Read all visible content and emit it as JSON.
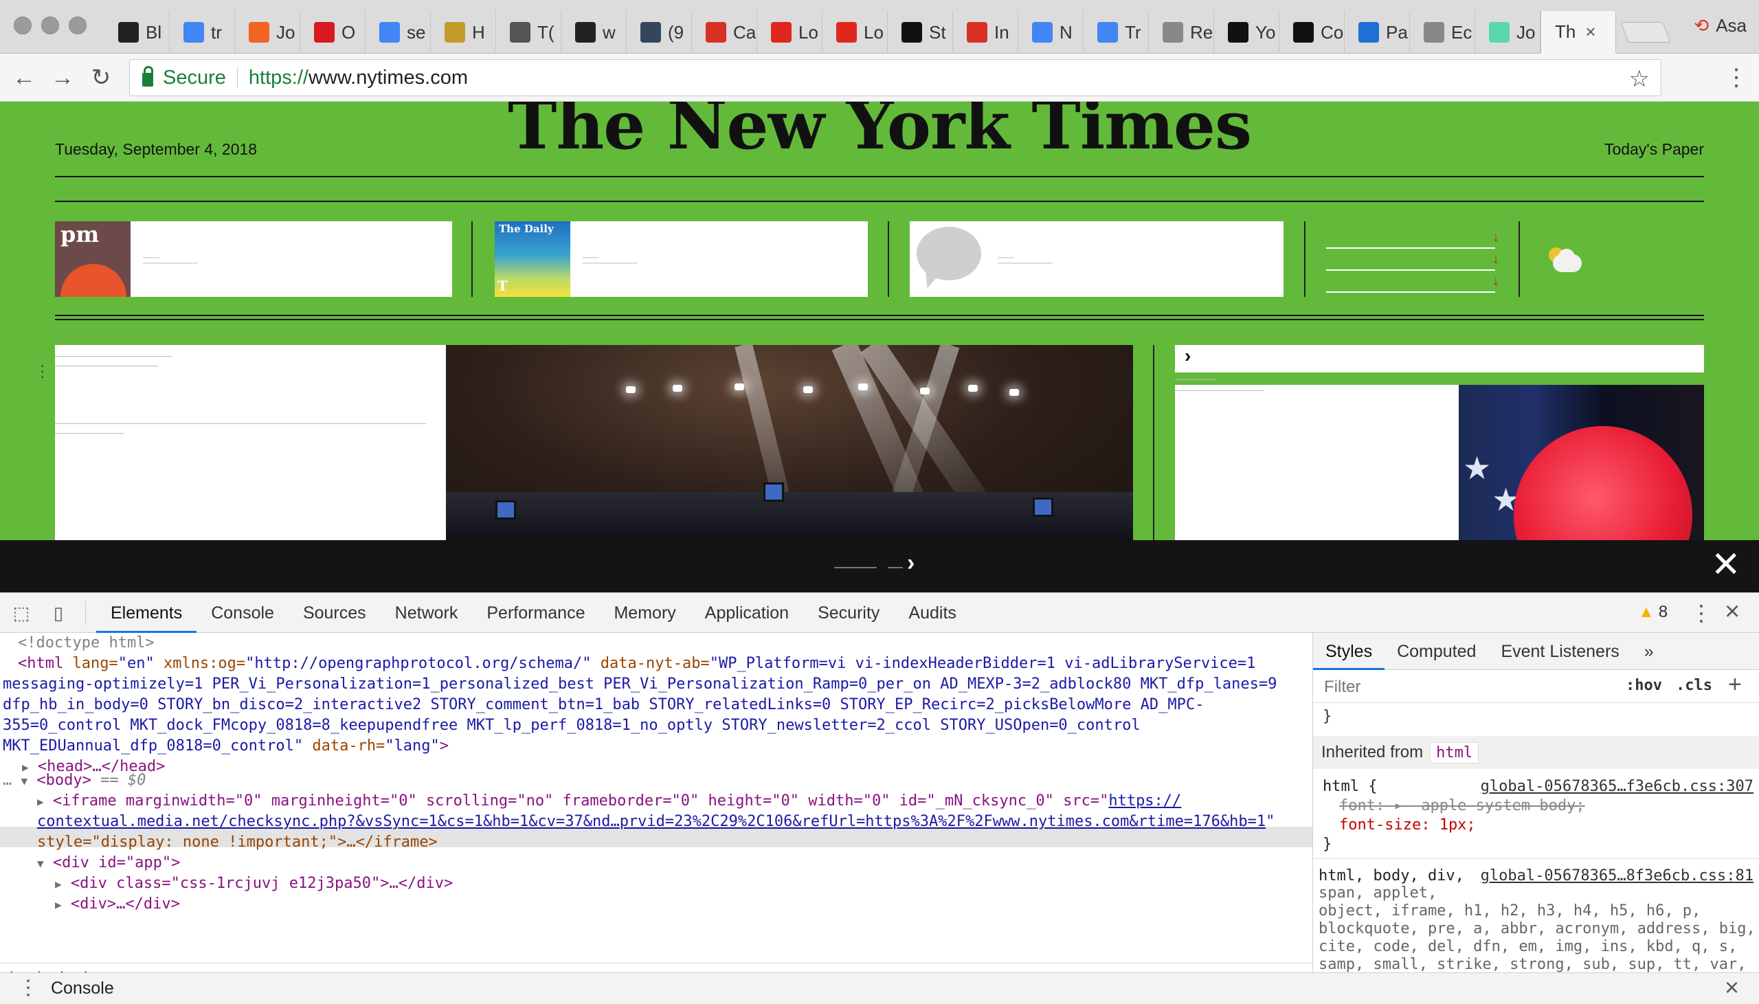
{
  "browser": {
    "tabs": [
      {
        "title": "Bl",
        "favicon": "wwd-icon",
        "color": "#222"
      },
      {
        "title": "tr",
        "favicon": "google-icon",
        "color": "#4285f4"
      },
      {
        "title": "Jo",
        "favicon": "orange-ring-icon",
        "color": "#f26522"
      },
      {
        "title": "O",
        "favicon": "target-ring-icon",
        "color": "#d71a21"
      },
      {
        "title": "se",
        "favicon": "google-icon",
        "color": "#4285f4"
      },
      {
        "title": "H",
        "favicon": "n-square-icon",
        "color": "#c29b2a"
      },
      {
        "title": "T(",
        "favicon": "cube-icon",
        "color": "#555"
      },
      {
        "title": "w",
        "favicon": "i-d-icon",
        "color": "#222"
      },
      {
        "title": "(9",
        "favicon": "tumblr-icon",
        "color": "#35465c"
      },
      {
        "title": "Ca",
        "favicon": "gmail-icon",
        "color": "#d93025"
      },
      {
        "title": "Lo",
        "favicon": "news-icon",
        "color": "#e0271e"
      },
      {
        "title": "Lo",
        "favicon": "news-icon",
        "color": "#e0271e"
      },
      {
        "title": "St",
        "favicon": "w-icon",
        "color": "#111"
      },
      {
        "title": "In",
        "favicon": "gmail-icon",
        "color": "#d93025"
      },
      {
        "title": "N",
        "favicon": "docs-icon",
        "color": "#4285f4"
      },
      {
        "title": "Tr",
        "favicon": "docs-icon",
        "color": "#4285f4"
      },
      {
        "title": "Re",
        "favicon": "page-icon",
        "color": "#888"
      },
      {
        "title": "Yo",
        "favicon": "github-icon",
        "color": "#111"
      },
      {
        "title": "Co",
        "favicon": "codepen-icon",
        "color": "#111"
      },
      {
        "title": "Pa",
        "favicon": "bars-icon",
        "color": "#1e6fd6"
      },
      {
        "title": "Ec",
        "favicon": "page-icon",
        "color": "#888"
      },
      {
        "title": "Jo",
        "favicon": "teal-square-icon",
        "color": "#5ad6b0"
      },
      {
        "title": "Th",
        "favicon": "",
        "color": "#333",
        "active": true
      }
    ],
    "profile_name": "Asa",
    "url_secure_label": "Secure",
    "url_scheme": "https://",
    "url_host": "www.nytimes.com"
  },
  "page": {
    "masthead": "The New York Times",
    "date": "Tuesday, September 4, 2018",
    "todays_paper": "Today's Paper",
    "promo_pm_thumb_text": "pm",
    "promo_daily_thumb_text": "The Daily",
    "promo_daily_logo": "T",
    "background_color": "#63ba3a"
  },
  "overlay": {
    "chevron": "›",
    "close": "✕"
  },
  "devtools": {
    "tabs": [
      "Elements",
      "Console",
      "Sources",
      "Network",
      "Performance",
      "Memory",
      "Application",
      "Security",
      "Audits"
    ],
    "active_tab": "Elements",
    "warning_count": "8",
    "dom_lines": {
      "doctype": "<!doctype html>",
      "html_attrs_1": "xmlns:og=",
      "html_og_val": "\"http://opengraphprotocol.org/schema/\"",
      "html_ab_attr": "data-nyt-ab=",
      "html_ab_val_1": "\"WP_Platform=vi vi-indexHeaderBidder=1 vi-adLibraryService=1",
      "html_ab_val_2": "messaging-optimizely=1 PER_Vi_Personalization=1_personalized_best PER_Vi_Personalization_Ramp=0_per_on AD_MEXP-3=2_adblock80 MKT_dfp_lanes=9",
      "html_ab_val_3": "dfp_hb_in_body=0 STORY_bn_disco=2_interactive2 STORY_comment_btn=1_bab STORY_relatedLinks=0 STORY_EP_Recirc=2_picksBelowMore AD_MPC-",
      "html_ab_val_4": "355=0_control MKT_dock_FMcopy_0818=8_keepupendfree MKT_lp_perf_0818=1_no_optly STORY_newsletter=2_ccol STORY_USOpen=0_control",
      "html_ab_val_5": "MKT_EDUannual_dfp_0818=0_control\"",
      "html_rh_attr": "data-rh=",
      "html_rh_val": "\"lang\"",
      "head": "<head>…</head>",
      "body": "<body>",
      "body_eq": "== $0",
      "iframe_1": "<iframe marginwidth=\"0\" marginheight=\"0\" scrolling=\"no\" frameborder=\"0\" height=\"0\" width=\"0\" id=\"_mN_cksync_0\" src=\"",
      "iframe_link_1": "https://",
      "iframe_link_2": "contextual.media.net/checksync.php?&vsSync=1&cs=1&hb=1&cv=37&nd…prvid=23%2C29%2C106&refUrl=https%3A%2F%2Fwww.nytimes.com&rtime=176&hb=1",
      "iframe_style": "style=\"display: none !important;\">…</iframe>",
      "div_app": "<div id=\"app\">",
      "div_class": "<div class=\"css-1rcjuvj e12j3pa50\">…</div>",
      "div_plain": "<div>…</div>"
    },
    "breadcrumb": [
      "html",
      "body"
    ],
    "styles_tabs": [
      "Styles",
      "Computed",
      "Event Listeners"
    ],
    "filter_placeholder": "Filter",
    "hov": ":hov",
    "cls": ".cls",
    "inherited_from": "Inherited from",
    "inherited_tag": "html",
    "rule1_selector": "html {",
    "rule1_source": "global-05678365…f3e6cb.css:307",
    "rule1_font_strike": "font: ▸ -apple-system-body;",
    "rule1_fontsize": "font-size: 1px;",
    "rule1_close": "}",
    "rule2_selector": "html, body, div,",
    "rule2_source": "global-05678365…8f3e6cb.css:81",
    "rule2_lines": [
      "span, applet,",
      "object, iframe, h1, h2, h3, h4, h5, h6, p,",
      "blockquote, pre, a, abbr, acronym, address, big,",
      "cite, code, del, dfn, em, img, ins, kbd, q, s,",
      "samp, small, strike, strong, sub, sup, tt, var,"
    ],
    "drawer_label": "Console"
  }
}
